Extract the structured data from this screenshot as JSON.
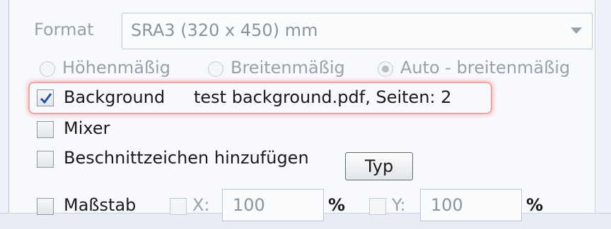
{
  "format": {
    "label": "Format",
    "value": "SRA3 (320 x 450) mm"
  },
  "orientation": {
    "options": [
      "Höhenmäßig",
      "Breitenmäßig",
      "Auto - breitenmäßig"
    ],
    "selected": "Auto - breitenmäßig"
  },
  "background": {
    "label": "Background",
    "checked": true,
    "info": "test background.pdf, Seiten: 2"
  },
  "mixer": {
    "label": "Mixer",
    "checked": false
  },
  "crop_marks": {
    "label": "Beschnittzeichen hinzufügen",
    "checked": false,
    "type_button": "Typ"
  },
  "scale": {
    "label": "Maßstab",
    "checked": false,
    "x_label": "X:",
    "x_value": "100",
    "y_label": "Y:",
    "y_value": "100",
    "unit": "%"
  },
  "colors": {
    "highlight": "#f2a2a2",
    "check": "#1f4fa8"
  }
}
